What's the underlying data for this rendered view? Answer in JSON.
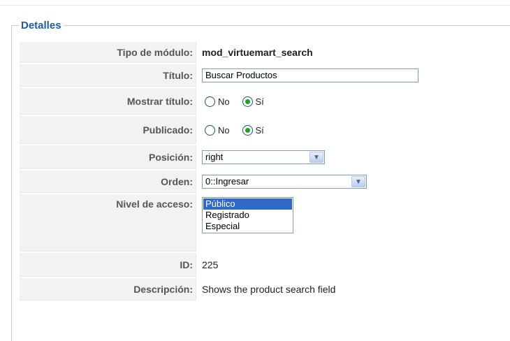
{
  "section": {
    "legend": "Detalles"
  },
  "rows": {
    "tipo": {
      "label": "Tipo de módulo:",
      "value": "mod_virtuemart_search"
    },
    "titulo": {
      "label": "Título:",
      "value": "Buscar Productos"
    },
    "mostrar_titulo": {
      "label": "Mostrar título:",
      "no": "No",
      "si": "Sí",
      "selected": "Sí"
    },
    "publicado": {
      "label": "Publicado:",
      "no": "No",
      "si": "Sí",
      "selected": "Sí"
    },
    "posicion": {
      "label": "Posición:",
      "value": "right"
    },
    "orden": {
      "label": "Orden:",
      "value": "0::Ingresar"
    },
    "nivel": {
      "label": "Nivel de acceso:",
      "options": [
        "Público",
        "Registrado",
        "Especial"
      ],
      "selected": "Público"
    },
    "id": {
      "label": "ID:",
      "value": "225"
    },
    "descripcion": {
      "label": "Descripción:",
      "value": "Shows the product search field"
    }
  },
  "colors": {
    "legend": "#1d5ba6",
    "label_bg": "#f2f2f2",
    "radio_checked": "#21a121",
    "listbox_selected": "#316ac5"
  },
  "icons": {
    "select_arrow": "chevron-down-icon"
  }
}
